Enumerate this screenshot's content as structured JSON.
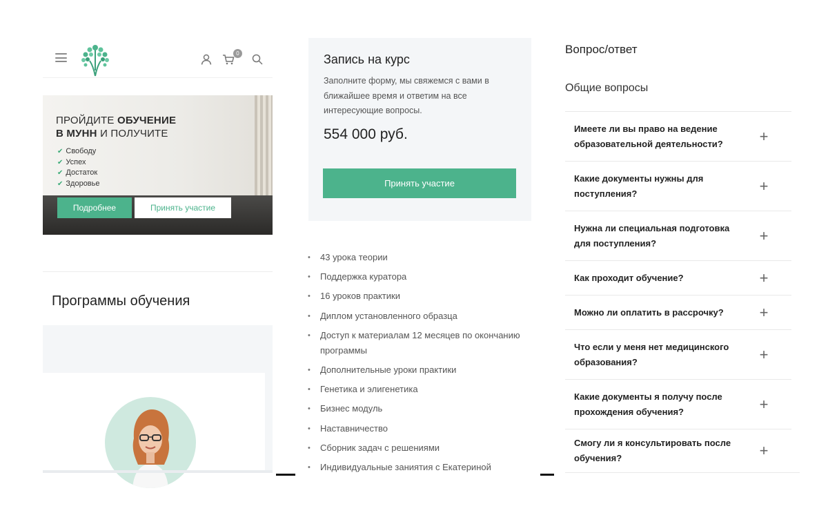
{
  "panel1": {
    "header": {
      "menu_icon": "hamburger-menu-icon",
      "logo_icon": "tree-logo-icon",
      "user_icon": "user-icon",
      "cart_icon": "cart-icon",
      "cart_count": "0",
      "search_icon": "search-icon"
    },
    "banner": {
      "title_part1": "ПРОЙДИТЕ ",
      "title_bold1": "ОБУЧЕНИЕ",
      "title_bold2": "В МУНН",
      "title_part2": " И ПОЛУЧИТЕ",
      "benefits": [
        "Свободу",
        "Успех",
        "Достаток",
        "Здоровье"
      ],
      "more_button": "Подробнее",
      "join_button": "Принять участие"
    },
    "programs_title": "Программы обучения"
  },
  "panel2": {
    "signup": {
      "title": "Запись на курс",
      "description": "Заполните форму, мы свяжемся с вами в ближайшее время и ответим на все интересующие вопросы.",
      "price": "554 000 руб.",
      "button": "Принять участие"
    },
    "features": [
      "43 урока теории",
      "Поддержка куратора",
      "16 уроков практики",
      "Диплом установленного образца",
      "Доступ к материалам 12 месяцев по окончанию программы",
      "Дополнительные уроки практики",
      "Генетика и элигенетика",
      "Бизнес модуль",
      "Наставничество",
      "Сборник задач с решениями",
      "Индивидуальные заниятия с Екатериной"
    ]
  },
  "panel3": {
    "title": "Вопрос/ответ",
    "subtitle": "Общие вопросы",
    "questions": [
      "Имеете ли вы право на ведение образовательной деятельности?",
      "Какие документы нужны для поступления?",
      "Нужна ли специальная подготовка для поступления?",
      "Как проходит обучение?",
      "Можно ли оплатить в рассрочку?",
      "Что если у меня нет медицинского образования?",
      "Какие документы я получу после прохождения обучения?",
      "Смогу ли я консультировать после обучения?"
    ],
    "expand_icon": "plus-icon"
  },
  "colors": {
    "accent_green": "#4cb38c",
    "panel_bg": "#f4f6f8",
    "text_dark": "#222222"
  }
}
